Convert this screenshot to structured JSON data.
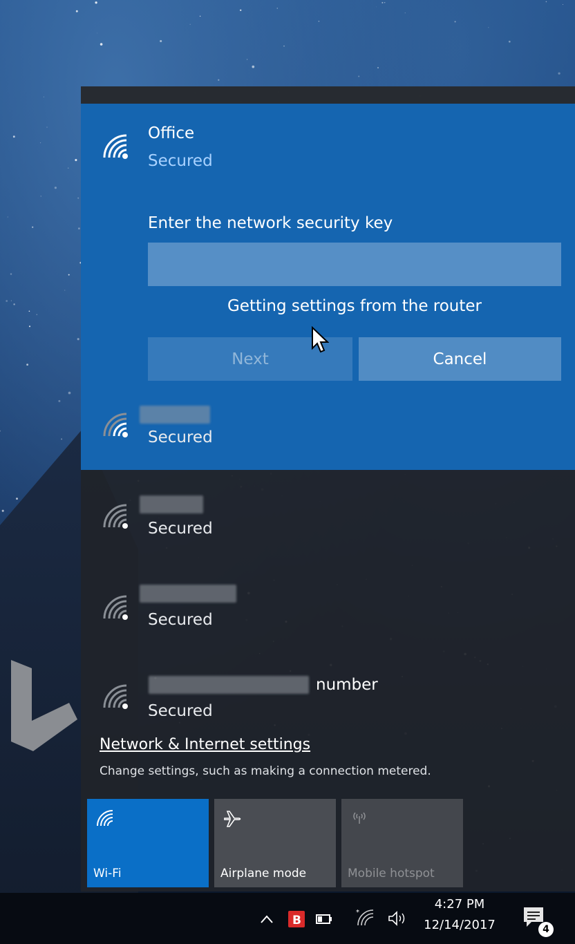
{
  "connect_panel": {
    "network_name": "Office",
    "network_status": "Secured",
    "key_label": "Enter the network security key",
    "key_value": "",
    "progress_text": "Getting settings from the router",
    "next_label": "Next",
    "cancel_label": "Cancel"
  },
  "networks": [
    {
      "name_visible": "",
      "status": "Secured"
    },
    {
      "name_visible": "",
      "status": "Secured"
    },
    {
      "name_visible": "",
      "status": "Secured"
    },
    {
      "name_visible": "number",
      "status": "Secured"
    }
  ],
  "settings": {
    "link_label": "Network & Internet settings",
    "description": "Change settings, such as making a connection metered."
  },
  "quick_actions": [
    {
      "label": "Wi-Fi",
      "icon": "wifi-icon",
      "state": "on"
    },
    {
      "label": "Airplane mode",
      "icon": "airplane-icon",
      "state": "off"
    },
    {
      "label": "Mobile hotspot",
      "icon": "hotspot-icon",
      "state": "disabled"
    }
  ],
  "taskbar": {
    "time": "4:27 PM",
    "date": "12/14/2017",
    "notification_count": "4",
    "icons": [
      "chevron-up-icon",
      "app-b-icon",
      "battery-icon",
      "wifi-icon",
      "volume-icon",
      "action-center-icon"
    ]
  },
  "colors": {
    "accent": "#1565b0",
    "wifi_tile": "#0a6fc7",
    "flyout_bg": "#20242a",
    "status_text": "#a9d2ff"
  }
}
